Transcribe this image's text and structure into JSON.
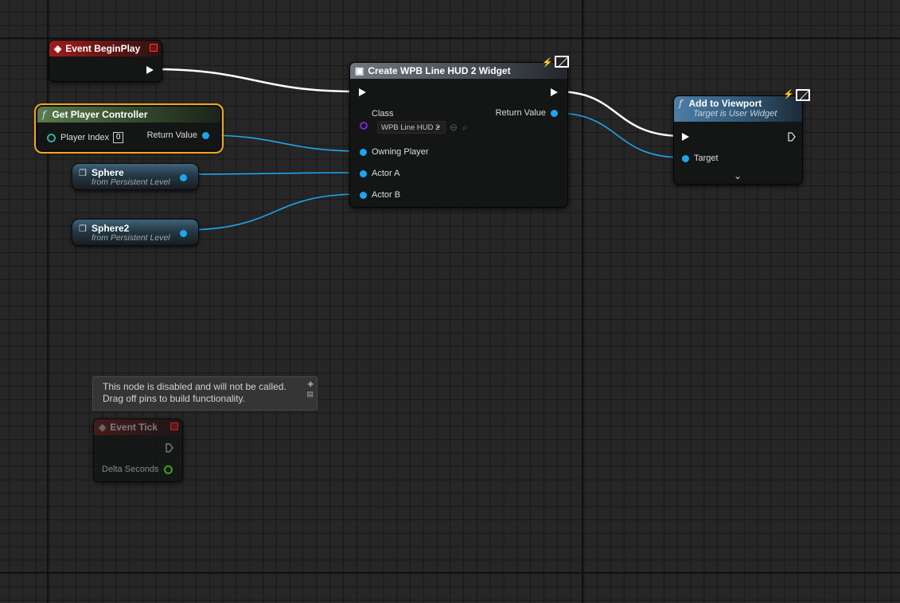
{
  "colors": {
    "background": "#262626",
    "exec_wire": "#ffffff",
    "object_wire": "#1da6ee",
    "selection": "#f3a51d",
    "event_header": "#9d1d1d",
    "pure_function_header": "#587c4c",
    "function_header": "#4d7ea6"
  },
  "event_begin_play": {
    "title": "Event BeginPlay"
  },
  "get_player_controller": {
    "title": "Get Player Controller",
    "player_index_label": "Player Index",
    "player_index_value": "0",
    "return_value_label": "Return Value"
  },
  "sphere": {
    "title": "Sphere",
    "subtitle": "from Persistent Level"
  },
  "sphere2": {
    "title": "Sphere2",
    "subtitle": "from Persistent Level"
  },
  "create_widget": {
    "title": "Create WPB Line HUD 2 Widget",
    "class_label": "Class",
    "class_value": "WPB Line HUD 2",
    "return_value_label": "Return Value",
    "owning_player_label": "Owning Player",
    "actor_a_label": "Actor A",
    "actor_b_label": "Actor B"
  },
  "add_to_viewport": {
    "title": "Add to Viewport",
    "subtitle": "Target is User Widget",
    "target_label": "Target"
  },
  "disabled_tooltip": {
    "line1": "This node is disabled and will not be called.",
    "line2": "Drag off pins to build functionality."
  },
  "event_tick": {
    "title": "Event Tick",
    "delta_seconds_label": "Delta Seconds"
  }
}
